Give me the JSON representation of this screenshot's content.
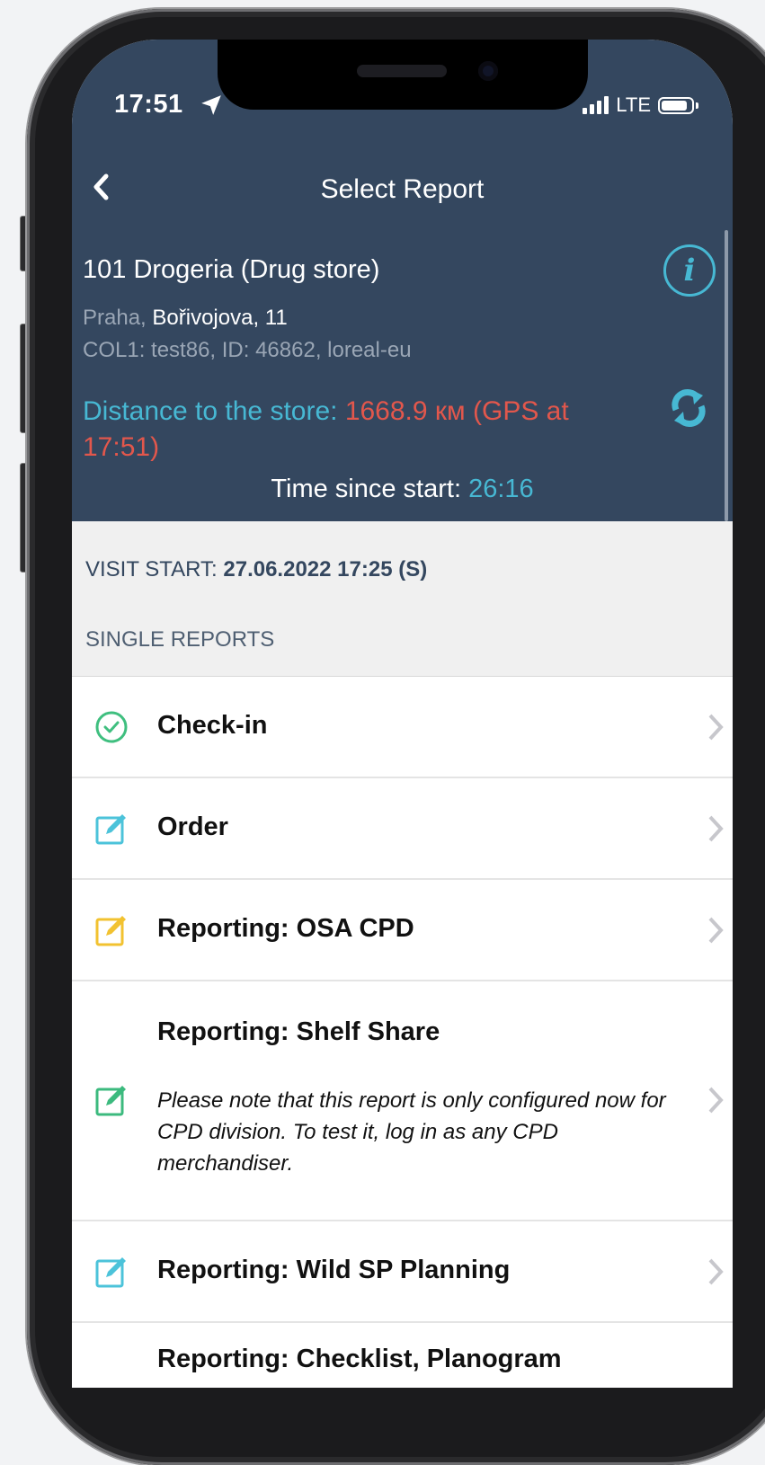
{
  "status_bar": {
    "time": "17:51",
    "network": "LTE"
  },
  "nav": {
    "title": "Select Report"
  },
  "store": {
    "name": "101 Drogeria (Drug store)",
    "city": "Praha,",
    "street": "Bořivojova, 11",
    "details": "COL1: test86, ID: 46862, loreal-eu",
    "distance_label": "Distance to the store: ",
    "distance_value": "1668.9 км (GPS at 17:51)",
    "time_label": "Time since start: ",
    "time_value": "26:16"
  },
  "visit": {
    "label": "VISIT START: ",
    "value": "27.06.2022 17:25 (S)"
  },
  "section_title": "SINGLE REPORTS",
  "reports": [
    {
      "label": "Check-in",
      "icon": "check-circle-icon",
      "color": "#3fbf7f"
    },
    {
      "label": "Order",
      "icon": "edit-icon",
      "color": "#4cc3da"
    },
    {
      "label": "Reporting: OSA CPD",
      "icon": "edit-icon",
      "color": "#f2c230"
    },
    {
      "label": "Reporting: Shelf Share",
      "icon": "edit-icon",
      "color": "#3cba7e",
      "note": "Please note that this report is only configured now for CPD division. To test it, log in as any CPD merchandiser."
    },
    {
      "label": "Reporting: Wild SP Planning",
      "icon": "edit-icon",
      "color": "#4cc3da"
    },
    {
      "label": "Reporting: Checklist, Planogram",
      "icon": "edit-icon",
      "color": "#4cc3da"
    }
  ]
}
